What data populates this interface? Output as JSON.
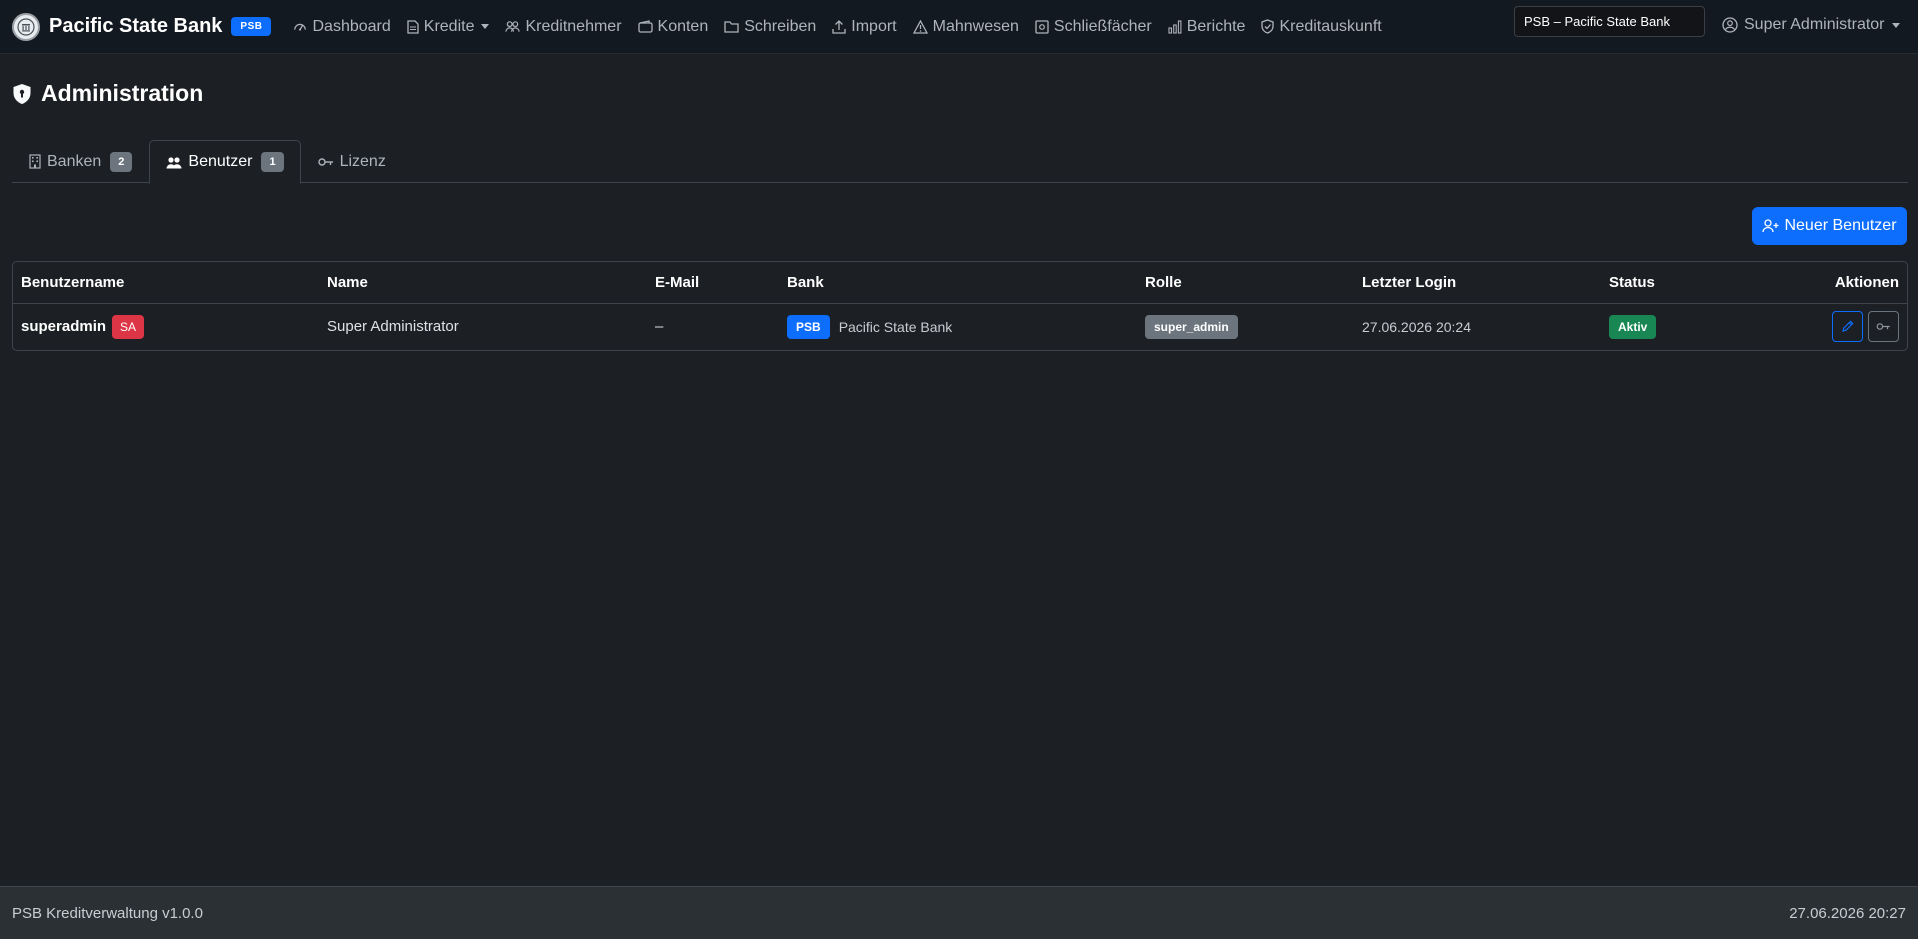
{
  "brand": {
    "name": "Pacific State Bank",
    "badge": "PSB"
  },
  "nav": {
    "items": [
      {
        "label": "Dashboard",
        "icon": "speedometer-icon"
      },
      {
        "label": "Kredite",
        "icon": "document-icon",
        "dropdown": true
      },
      {
        "label": "Kreditnehmer",
        "icon": "people-icon"
      },
      {
        "label": "Konten",
        "icon": "wallet-icon"
      },
      {
        "label": "Schreiben",
        "icon": "folder-icon"
      },
      {
        "label": "Import",
        "icon": "upload-icon"
      },
      {
        "label": "Mahnwesen",
        "icon": "warning-icon"
      },
      {
        "label": "Schließfächer",
        "icon": "safe-icon"
      },
      {
        "label": "Berichte",
        "icon": "bar-chart-icon"
      },
      {
        "label": "Kreditauskunft",
        "icon": "shield-check-icon"
      }
    ],
    "bank_selector": "PSB – Pacific State Bank",
    "user_label": "Super Administrator"
  },
  "page": {
    "title": "Administration"
  },
  "tabs": [
    {
      "label": "Banken",
      "count": "2",
      "active": false,
      "icon": "building-icon"
    },
    {
      "label": "Benutzer",
      "count": "1",
      "active": true,
      "icon": "people-icon"
    },
    {
      "label": "Lizenz",
      "count": null,
      "active": false,
      "icon": "key-icon"
    }
  ],
  "actions": {
    "new_user_label": "Neuer Benutzer"
  },
  "table": {
    "headers": {
      "username": "Benutzername",
      "name": "Name",
      "email": "E-Mail",
      "bank": "Bank",
      "role": "Rolle",
      "last_login": "Letzter Login",
      "status": "Status",
      "actions": "Aktionen"
    },
    "rows": [
      {
        "username": "superadmin",
        "user_badge": "SA",
        "name": "Super Administrator",
        "email": "–",
        "bank_code": "PSB",
        "bank_name": "Pacific State Bank",
        "role": "super_admin",
        "last_login": "27.06.2026 20:24",
        "status": "Aktiv"
      }
    ]
  },
  "footer": {
    "left": "PSB Kreditverwaltung v1.0.0",
    "right": "27.06.2026 20:27"
  },
  "colors": {
    "primary": "#0d6efd",
    "danger": "#dc3545",
    "success": "#198754",
    "secondary": "#6c757d",
    "background": "#1c1f24"
  }
}
